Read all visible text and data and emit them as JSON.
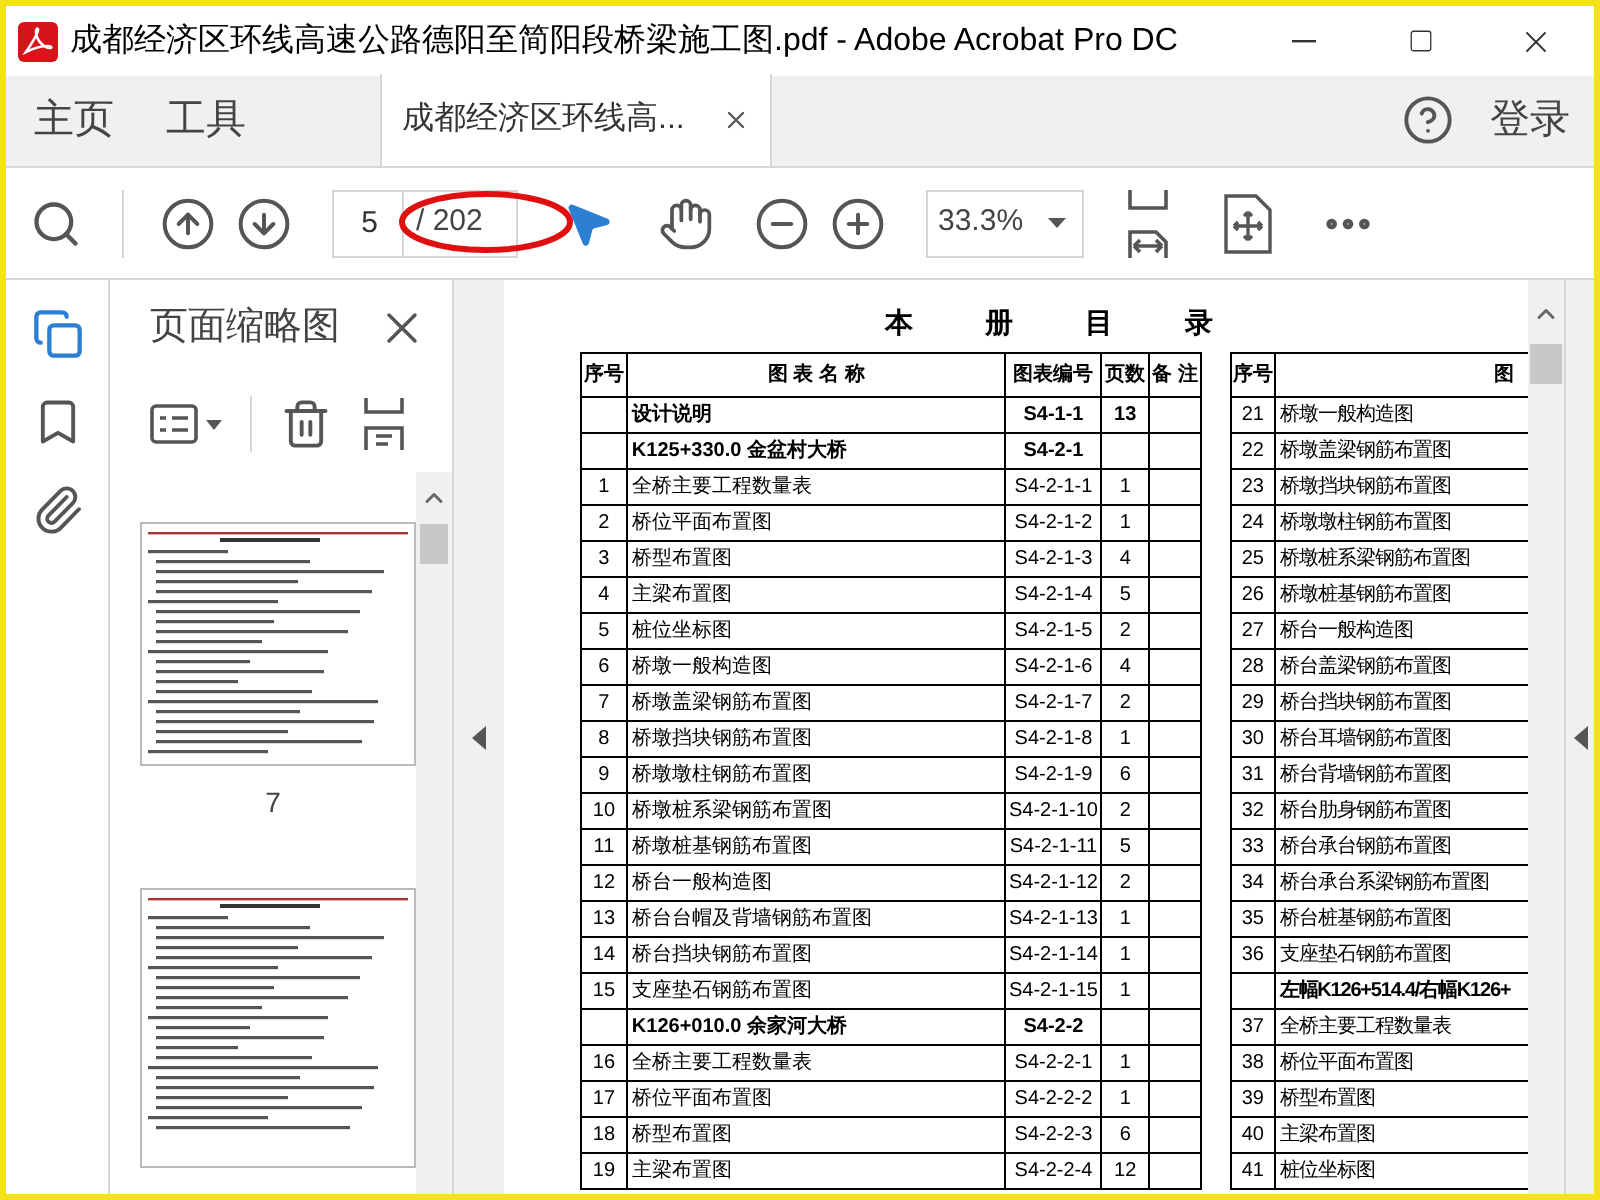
{
  "window": {
    "title": "成都经济区环线高速公路德阳至简阳段桥梁施工图.pdf - Adobe Acrobat Pro DC"
  },
  "nav_tabs": [
    {
      "label": "主页"
    },
    {
      "label": "工具"
    }
  ],
  "document_tabs": [
    {
      "label": "成都经济区环线高...",
      "selected": true
    }
  ],
  "account": {
    "label": "登录"
  },
  "toolbar": {
    "page": "5",
    "page_total": "/ 202",
    "zoom": "33.3%"
  },
  "thumbnails_panel": {
    "title": "页面缩略图",
    "thumbnail_labels": [
      "7"
    ]
  },
  "document": {
    "title": "本 册 目 录",
    "left_table": {
      "columns": [
        "序号",
        "图 表 名 称",
        "图表编号",
        "页数",
        "备 注"
      ],
      "rows": [
        {
          "kind": "section",
          "name": "设计说明",
          "code": "S4-1-1",
          "pages": "13"
        },
        {
          "kind": "section",
          "name": "K125+330.0 金盆村大桥",
          "code": "S4-2-1"
        },
        {
          "kind": "item",
          "no": "1",
          "name": "全桥主要工程数量表",
          "code": "S4-2-1-1",
          "pages": "1"
        },
        {
          "kind": "item",
          "no": "2",
          "name": "桥位平面布置图",
          "code": "S4-2-1-2",
          "pages": "1"
        },
        {
          "kind": "item",
          "no": "3",
          "name": "桥型布置图",
          "code": "S4-2-1-3",
          "pages": "4"
        },
        {
          "kind": "item",
          "no": "4",
          "name": "主梁布置图",
          "code": "S4-2-1-4",
          "pages": "5"
        },
        {
          "kind": "item",
          "no": "5",
          "name": "桩位坐标图",
          "code": "S4-2-1-5",
          "pages": "2"
        },
        {
          "kind": "item",
          "no": "6",
          "name": "桥墩一般构造图",
          "code": "S4-2-1-6",
          "pages": "4"
        },
        {
          "kind": "item",
          "no": "7",
          "name": "桥墩盖梁钢筋布置图",
          "code": "S4-2-1-7",
          "pages": "2"
        },
        {
          "kind": "item",
          "no": "8",
          "name": "桥墩挡块钢筋布置图",
          "code": "S4-2-1-8",
          "pages": "1"
        },
        {
          "kind": "item",
          "no": "9",
          "name": "桥墩墩柱钢筋布置图",
          "code": "S4-2-1-9",
          "pages": "6"
        },
        {
          "kind": "item",
          "no": "10",
          "name": "桥墩桩系梁钢筋布置图",
          "code": "S4-2-1-10",
          "pages": "2"
        },
        {
          "kind": "item",
          "no": "11",
          "name": "桥墩桩基钢筋布置图",
          "code": "S4-2-1-11",
          "pages": "5"
        },
        {
          "kind": "item",
          "no": "12",
          "name": "桥台一般构造图",
          "code": "S4-2-1-12",
          "pages": "2"
        },
        {
          "kind": "item",
          "no": "13",
          "name": "桥台台帽及背墙钢筋布置图",
          "code": "S4-2-1-13",
          "pages": "1"
        },
        {
          "kind": "item",
          "no": "14",
          "name": "桥台挡块钢筋布置图",
          "code": "S4-2-1-14",
          "pages": "1"
        },
        {
          "kind": "item",
          "no": "15",
          "name": "支座垫石钢筋布置图",
          "code": "S4-2-1-15",
          "pages": "1"
        },
        {
          "kind": "section",
          "name": "K126+010.0 余家河大桥",
          "code": "S4-2-2"
        },
        {
          "kind": "item",
          "no": "16",
          "name": "全桥主要工程数量表",
          "code": "S4-2-2-1",
          "pages": "1"
        },
        {
          "kind": "item",
          "no": "17",
          "name": "桥位平面布置图",
          "code": "S4-2-2-2",
          "pages": "1"
        },
        {
          "kind": "item",
          "no": "18",
          "name": "桥型布置图",
          "code": "S4-2-2-3",
          "pages": "6"
        },
        {
          "kind": "item",
          "no": "19",
          "name": "主梁布置图",
          "code": "S4-2-2-4",
          "pages": "12"
        }
      ]
    },
    "right_table": {
      "columns": [
        "序号",
        "图"
      ],
      "rows": [
        {
          "kind": "item",
          "no": "21",
          "name": "桥墩一般构造图"
        },
        {
          "kind": "item",
          "no": "22",
          "name": "桥墩盖梁钢筋布置图"
        },
        {
          "kind": "item",
          "no": "23",
          "name": "桥墩挡块钢筋布置图"
        },
        {
          "kind": "item",
          "no": "24",
          "name": "桥墩墩柱钢筋布置图"
        },
        {
          "kind": "item",
          "no": "25",
          "name": "桥墩桩系梁钢筋布置图"
        },
        {
          "kind": "item",
          "no": "26",
          "name": "桥墩桩基钢筋布置图"
        },
        {
          "kind": "item",
          "no": "27",
          "name": "桥台一般构造图"
        },
        {
          "kind": "item",
          "no": "28",
          "name": "桥台盖梁钢筋布置图"
        },
        {
          "kind": "item",
          "no": "29",
          "name": "桥台挡块钢筋布置图"
        },
        {
          "kind": "item",
          "no": "30",
          "name": "桥台耳墙钢筋布置图"
        },
        {
          "kind": "item",
          "no": "31",
          "name": "桥台背墙钢筋布置图"
        },
        {
          "kind": "item",
          "no": "32",
          "name": "桥台肋身钢筋布置图"
        },
        {
          "kind": "item",
          "no": "33",
          "name": "桥台承台钢筋布置图"
        },
        {
          "kind": "item",
          "no": "34",
          "name": "桥台承台系梁钢筋布置图"
        },
        {
          "kind": "item",
          "no": "35",
          "name": "桥台桩基钢筋布置图"
        },
        {
          "kind": "item",
          "no": "36",
          "name": "支座垫石钢筋布置图"
        },
        {
          "kind": "section",
          "name": "左幅K126+514.4/右幅K126+"
        },
        {
          "kind": "item",
          "no": "37",
          "name": "全桥主要工程数量表"
        },
        {
          "kind": "item",
          "no": "38",
          "name": "桥位平面布置图"
        },
        {
          "kind": "item",
          "no": "39",
          "name": "桥型布置图"
        },
        {
          "kind": "item",
          "no": "40",
          "name": "主梁布置图"
        },
        {
          "kind": "item",
          "no": "41",
          "name": "桩位坐标图"
        }
      ]
    }
  }
}
